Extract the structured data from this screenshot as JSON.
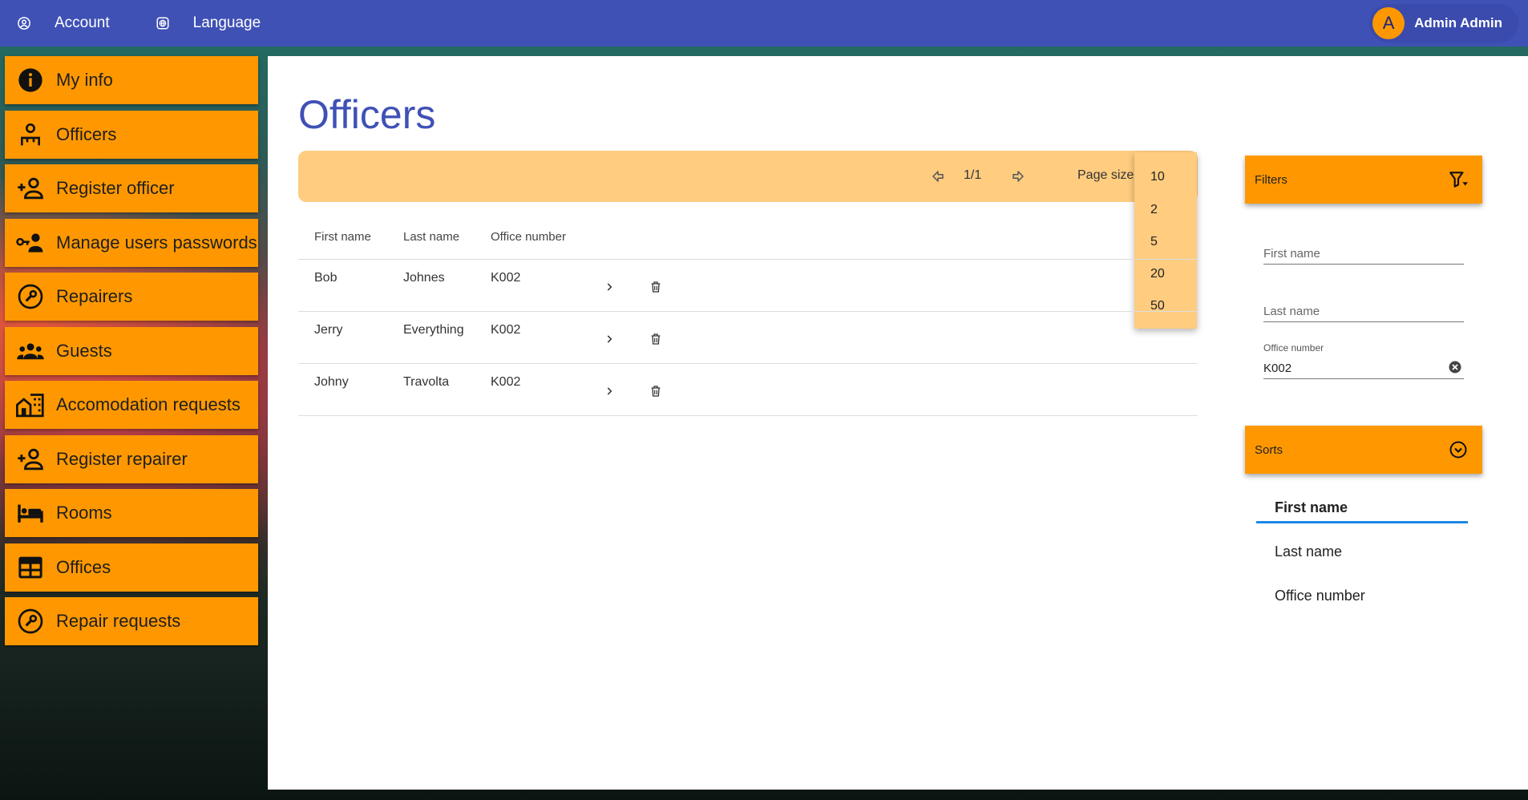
{
  "topbar": {
    "account_label": "Account",
    "language_label": "Language",
    "user_initial": "A",
    "user_name": "Admin Admin"
  },
  "sidebar": {
    "items": [
      {
        "label": "My info",
        "icon": "info-icon"
      },
      {
        "label": "Officers",
        "icon": "officer-icon"
      },
      {
        "label": "Register officer",
        "icon": "person-add-icon"
      },
      {
        "label": "Manage users passwords",
        "icon": "key-person-icon"
      },
      {
        "label": "Repairers",
        "icon": "wrench-icon"
      },
      {
        "label": "Guests",
        "icon": "group-icon"
      },
      {
        "label": "Accomodation requests",
        "icon": "building-icon"
      },
      {
        "label": "Register repairer",
        "icon": "person-add-icon"
      },
      {
        "label": "Rooms",
        "icon": "bed-icon"
      },
      {
        "label": "Offices",
        "icon": "table-icon"
      },
      {
        "label": "Repair requests",
        "icon": "wrench-icon"
      }
    ]
  },
  "main": {
    "title": "Officers",
    "pager": {
      "page": "1/1",
      "page_size_label": "Page size:",
      "page_size_options": [
        "10",
        "2",
        "5",
        "20",
        "50"
      ]
    },
    "table": {
      "columns": [
        "First name",
        "Last name",
        "Office number"
      ],
      "rows": [
        {
          "first": "Bob",
          "last": "Johnes",
          "office": "K002"
        },
        {
          "first": "Jerry",
          "last": "Everything",
          "office": "K002"
        },
        {
          "first": "Johny",
          "last": "Travolta",
          "office": "K002"
        }
      ]
    }
  },
  "filters": {
    "title": "Filters",
    "first_name_placeholder": "First name",
    "last_name_placeholder": "Last name",
    "office_number_label": "Office number",
    "office_number_value": "K002"
  },
  "sorts": {
    "title": "Sorts",
    "options": [
      "First name",
      "Last name",
      "Office number"
    ]
  },
  "colors": {
    "primary": "#3f51b5",
    "accent": "#ff9800",
    "accent_light": "#ffcc80",
    "selected_underline": "#1e88e5"
  }
}
